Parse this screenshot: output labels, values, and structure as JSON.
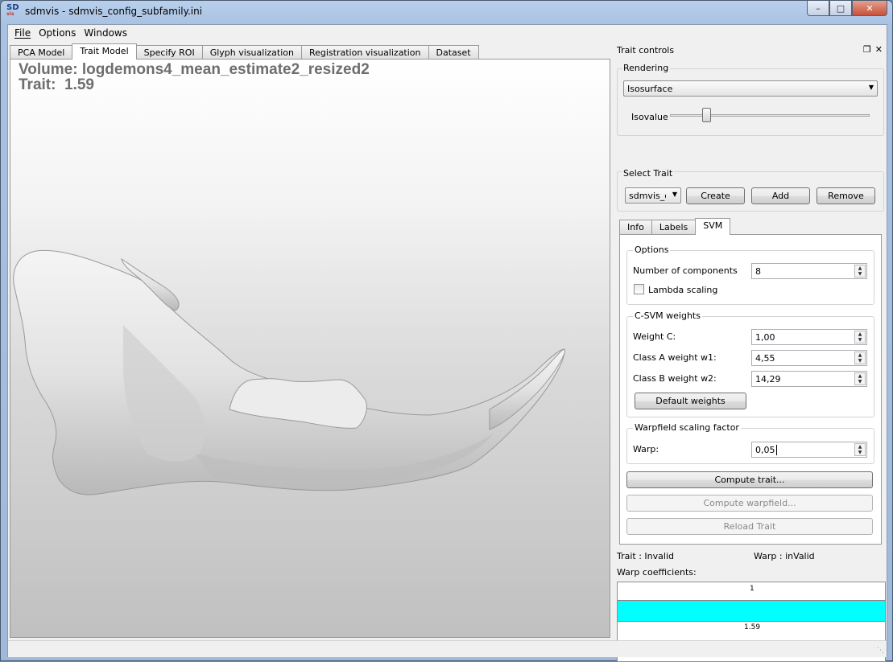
{
  "window": {
    "title": "sdmvis - sdmvis_config_subfamily.ini",
    "icon_text_top": "SD",
    "icon_text_bottom": "vis",
    "minimize": "–",
    "maximize": "□",
    "close": "✕"
  },
  "menu": {
    "file": "File",
    "options": "Options",
    "windows": "Windows"
  },
  "tabs": [
    {
      "label": "PCA Model"
    },
    {
      "label": "Trait Model"
    },
    {
      "label": "Specify ROI"
    },
    {
      "label": "Glyph visualization"
    },
    {
      "label": "Registration visualization"
    },
    {
      "label": "Dataset"
    }
  ],
  "viewport": {
    "volume_label": "Volume: logdemons4_mean_estimate2_resized2",
    "trait_label": "Trait:  1.59"
  },
  "panel": {
    "title": "Trait controls",
    "float_icon": "❐",
    "close_icon": "✕",
    "rendering": {
      "group_label": "Rendering",
      "mode": "Isosurface",
      "isovalue_label": "Isovalue",
      "isovalue_fraction": 0.17
    },
    "select_trait": {
      "group_label": "Select Trait",
      "current": "sdmvis_cc",
      "create": "Create",
      "add": "Add",
      "remove": "Remove"
    },
    "subtabs": [
      {
        "label": "Info"
      },
      {
        "label": "Labels"
      },
      {
        "label": "SVM"
      }
    ],
    "svm": {
      "options_label": "Options",
      "num_components_label": "Number of components",
      "num_components": "8",
      "lambda_label": "Lambda scaling",
      "lambda_checked": false,
      "weights_label": "C-SVM weights",
      "weight_c_label": "Weight C:",
      "weight_c": "1,00",
      "class_a_label": "Class A weight w1:",
      "class_a": "4,55",
      "class_b_label": "Class B weight w2:",
      "class_b": "14,29",
      "default_weights": "Default weights",
      "warp_group_label": "Warpfield scaling factor",
      "warp_label": "Warp:",
      "warp": "0,05",
      "compute_trait": "Compute trait...",
      "compute_warpfield": "Compute warpfield...",
      "reload_trait": "Reload Trait"
    },
    "status": {
      "trait_status": "Trait :  Invalid",
      "warp_status": "Warp : inValid",
      "warp_coefficients_label": "Warp coefficients:",
      "coef_top": "1",
      "coef_bottom": "1.59"
    }
  },
  "colors": {
    "warp_bar": "#00ffff",
    "viewport_text": "#6e6e6e"
  }
}
